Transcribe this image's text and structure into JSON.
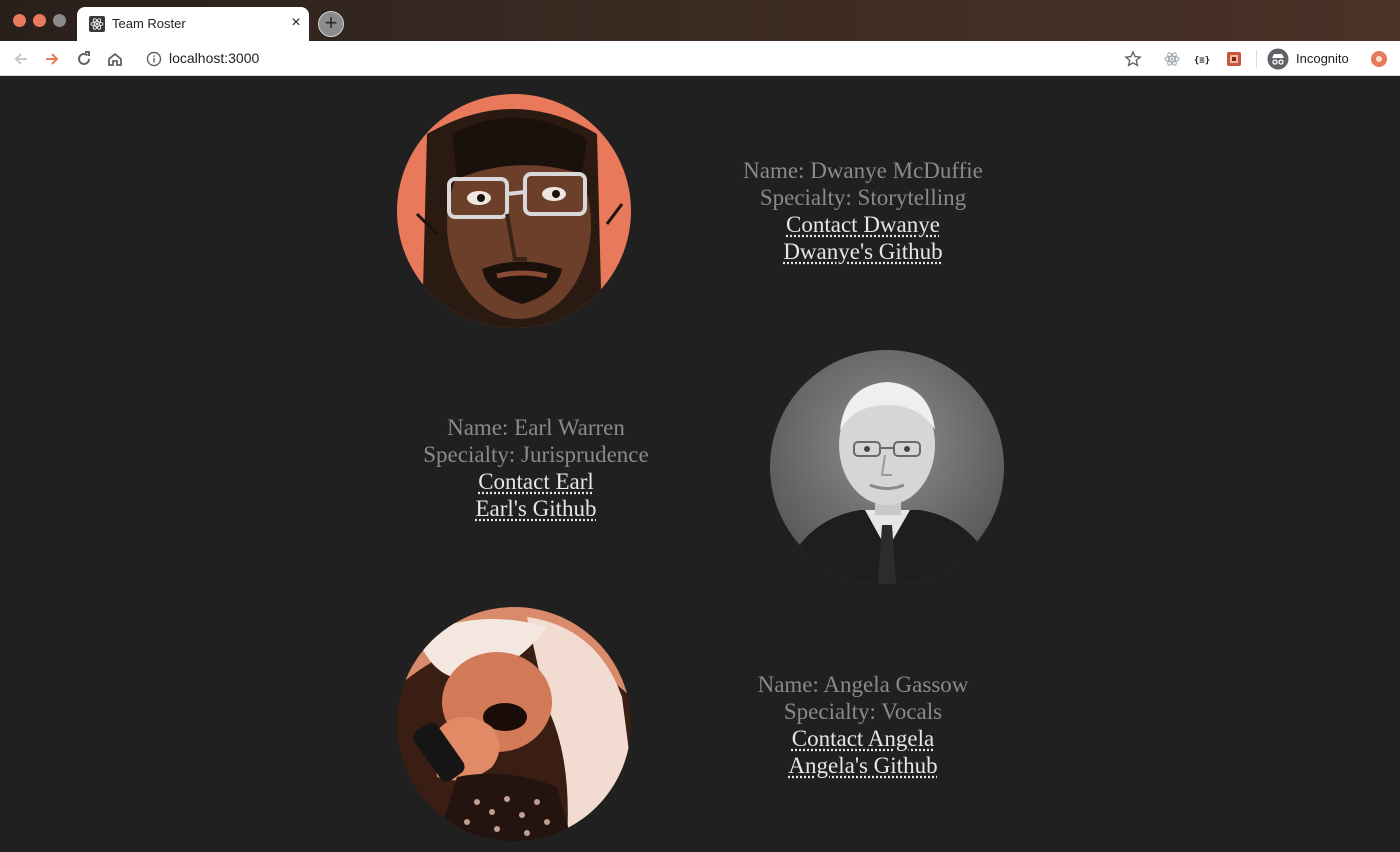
{
  "browser": {
    "tab_title": "Team Roster",
    "tab_close": "×",
    "new_tab": "+",
    "url": "localhost:3000",
    "profile_label": "Incognito"
  },
  "members": [
    {
      "name_line": "Name: Dwanye McDuffie",
      "specialty_line": "Specialty: Storytelling",
      "contact_label": "Contact Dwanye",
      "github_label": "Dwanye's Github"
    },
    {
      "name_line": "Name: Earl Warren",
      "specialty_line": "Specialty: Jurisprudence",
      "contact_label": "Contact Earl",
      "github_label": "Earl's Github"
    },
    {
      "name_line": "Name: Angela Gassow",
      "specialty_line": "Specialty: Vocals",
      "contact_label": "Contact Angela",
      "github_label": "Angela's Github"
    }
  ],
  "colors": {
    "page_background": "#1f201f",
    "label_text": "#8a8a8a",
    "link_text": "#e6e6e6",
    "accent_orange": "#e8795a"
  }
}
